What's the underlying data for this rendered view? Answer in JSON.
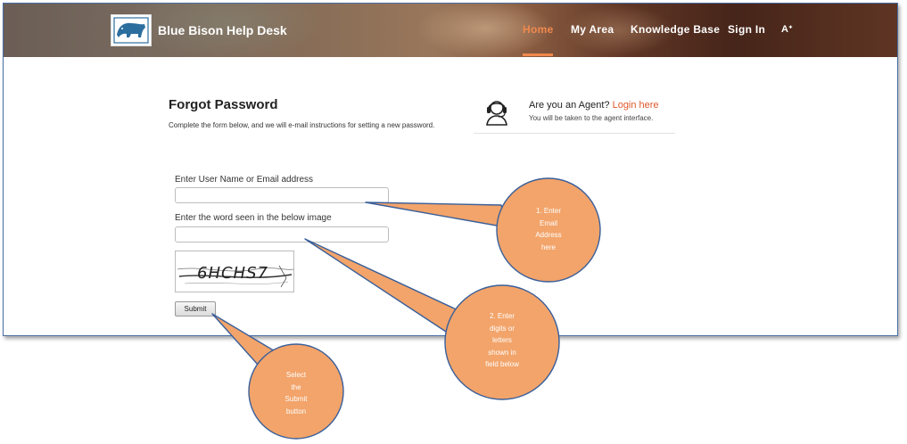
{
  "header": {
    "brand": "Blue Bison Help Desk",
    "nav": [
      {
        "label": "Home",
        "active": true
      },
      {
        "label": "My Area",
        "active": false
      },
      {
        "label": "Knowledge Base",
        "active": false
      },
      {
        "label": "Sign In",
        "active": false
      }
    ],
    "font_size_icon": "Aᐩ",
    "accent_color": "#f0884d"
  },
  "form": {
    "title": "Forgot Password",
    "description": "Complete the form below, and we will e-mail instructions for setting a new password.",
    "username_label": "Enter User Name or Email address",
    "username_value": "",
    "captcha_label": "Enter the word seen in the below image",
    "captcha_value": "",
    "captcha_text": "6HCHS7",
    "submit_label": "Submit"
  },
  "agent": {
    "question": "Are you an Agent?",
    "login_link": "Login here",
    "note": "You will be taken to the agent interface."
  },
  "callouts": [
    {
      "text": "1. Enter\nEmail\nAddress\nhere",
      "color": "#f2a46a"
    },
    {
      "text": "2. Enter\ndigits or\nletters\nshown in\nfield below",
      "color": "#f2a46a"
    },
    {
      "text": "Select\nthe\nSubmit\nbutton",
      "color": "#f2a46a"
    }
  ]
}
